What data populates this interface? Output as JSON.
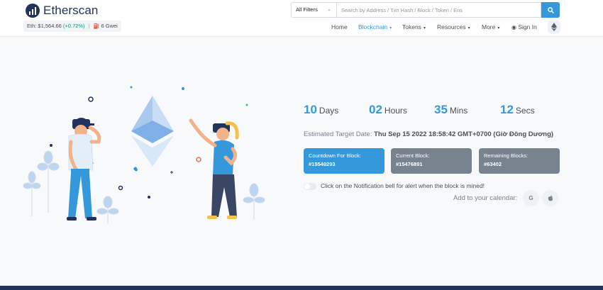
{
  "brand": {
    "name": "Etherscan"
  },
  "price": {
    "label": "Eth: $1,564.66",
    "change": "(+0.72%)",
    "separator": "|",
    "gas": "6 Gwei"
  },
  "search": {
    "filter": "All Filters",
    "placeholder": "Search by Address / Txn Hash / Block / Token / Ens"
  },
  "nav": {
    "items": [
      {
        "label": "Home"
      },
      {
        "label": "Blockchain"
      },
      {
        "label": "Tokens"
      },
      {
        "label": "Resources"
      },
      {
        "label": "More"
      },
      {
        "label": "Sign In"
      }
    ]
  },
  "countdown": {
    "days": {
      "value": "10",
      "unit": "Days"
    },
    "hours": {
      "value": "02",
      "unit": "Hours"
    },
    "mins": {
      "value": "35",
      "unit": "Mins"
    },
    "secs": {
      "value": "12",
      "unit": "Secs"
    }
  },
  "target": {
    "label": "Estimated Target Date:",
    "date": "Thu Sep 15 2022 18:58:42 GMT+0700 (Giờ Đông Dương)"
  },
  "blocks": {
    "countdown": {
      "label": "Countdown For Block:",
      "value": "#15540293"
    },
    "current": {
      "label": "Current Block:",
      "value": "#15476891"
    },
    "remaining": {
      "label": "Remaining Blocks:",
      "value": "#63402"
    }
  },
  "notify": {
    "text": "Click on the Notification bell for alert when the block is mined!"
  },
  "calendar": {
    "label": "Add to your calendar:",
    "google": "G"
  },
  "colors": {
    "primary": "#3498db",
    "gray": "#77838f",
    "navy": "#21325b",
    "success": "#00a186"
  }
}
